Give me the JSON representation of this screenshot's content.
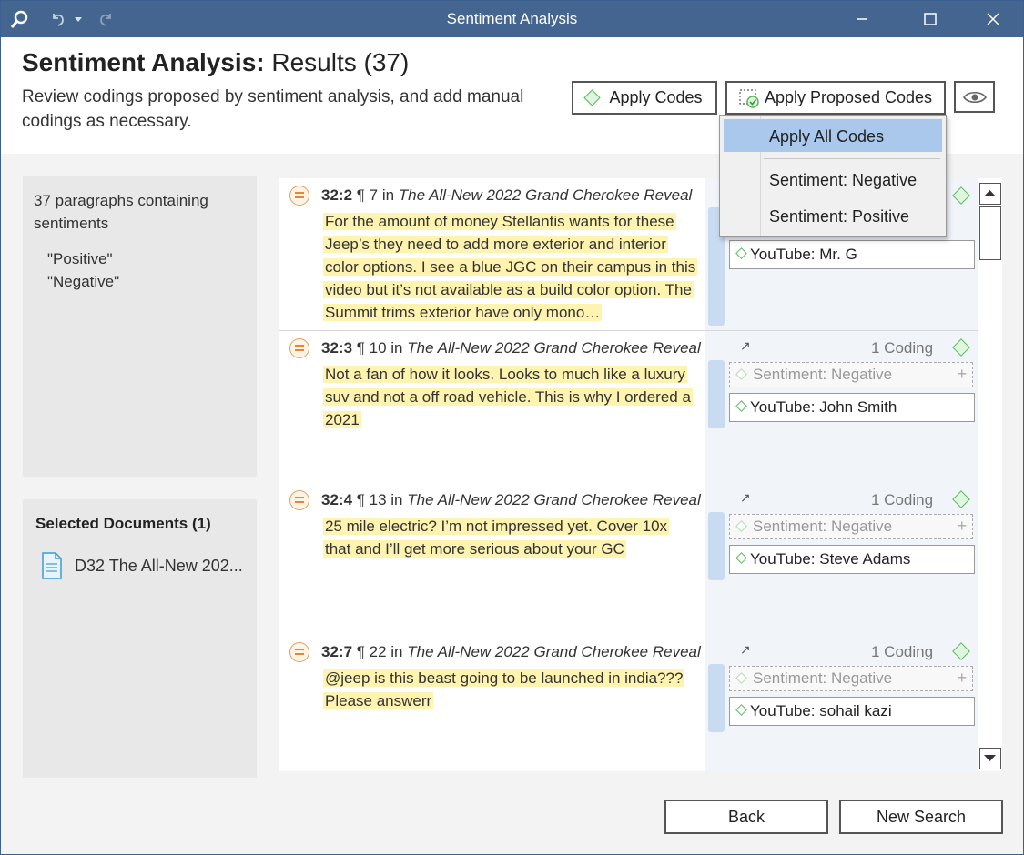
{
  "window": {
    "title": "Sentiment Analysis"
  },
  "header": {
    "title_bold": "Sentiment Analysis:",
    "title_rest": "Results (37)",
    "description": "Review codings proposed by sentiment analysis, and add manual codings as necessary.",
    "apply_codes_label": "Apply Codes",
    "apply_proposed_label": "Apply Proposed Codes"
  },
  "dropdown": {
    "items": [
      "Apply All Codes",
      "Sentiment: Negative",
      "Sentiment: Positive"
    ]
  },
  "summary": {
    "text": "37 paragraphs containing sentiments",
    "sentiments": [
      "\"Positive\"",
      "\"Negative\""
    ]
  },
  "selected_docs": {
    "title": "Selected Documents (1)",
    "items": [
      "D32 The All-New 202..."
    ]
  },
  "results": [
    {
      "ref": "32:2",
      "para": "¶ 7",
      "in": "in",
      "doc": "The All-New 2022 Grand Cherokee Reveal",
      "text": "For the amount of money Stellantis wants for these Jeep’s they need to add more exterior and interior color options. I see a blue JGC on their campus in this video but it’s not available as a build color option. The Summit trims exterior have only mono…",
      "coding_count": "",
      "proposed": "",
      "code": "YouTube: Mr. G"
    },
    {
      "ref": "32:3",
      "para": "¶ 10",
      "in": "in",
      "doc": "The All-New 2022 Grand Cherokee Reveal",
      "text": "Not a fan of how it looks. Looks to much like a luxury suv and not a off road vehicle. This is why I ordered a 2021",
      "coding_count": "1 Coding",
      "proposed": "Sentiment: Negative",
      "code": "YouTube: John Smith"
    },
    {
      "ref": "32:4",
      "para": "¶ 13",
      "in": "in",
      "doc": "The All-New 2022 Grand Cherokee Reveal",
      "text": "25 mile electric? I’m not impressed yet. Cover 10x that and I’ll get more serious about your GC",
      "coding_count": "1 Coding",
      "proposed": "Sentiment: Negative",
      "code": "YouTube: Steve Adams"
    },
    {
      "ref": "32:7",
      "para": "¶ 22",
      "in": "in",
      "doc": "The All-New 2022 Grand Cherokee Reveal",
      "text": "@jeep is this beast going to be launched in india??? Please answerr",
      "coding_count": "1 Coding",
      "proposed": "Sentiment: Negative",
      "code": "YouTube: sohail kazi"
    }
  ],
  "footer": {
    "back_label": "Back",
    "new_search_label": "New Search"
  },
  "colors": {
    "titlebar": "#44658f",
    "highlight": "#fff3b0",
    "selection": "#a9c8ec",
    "code_green": "#5cb85c"
  }
}
